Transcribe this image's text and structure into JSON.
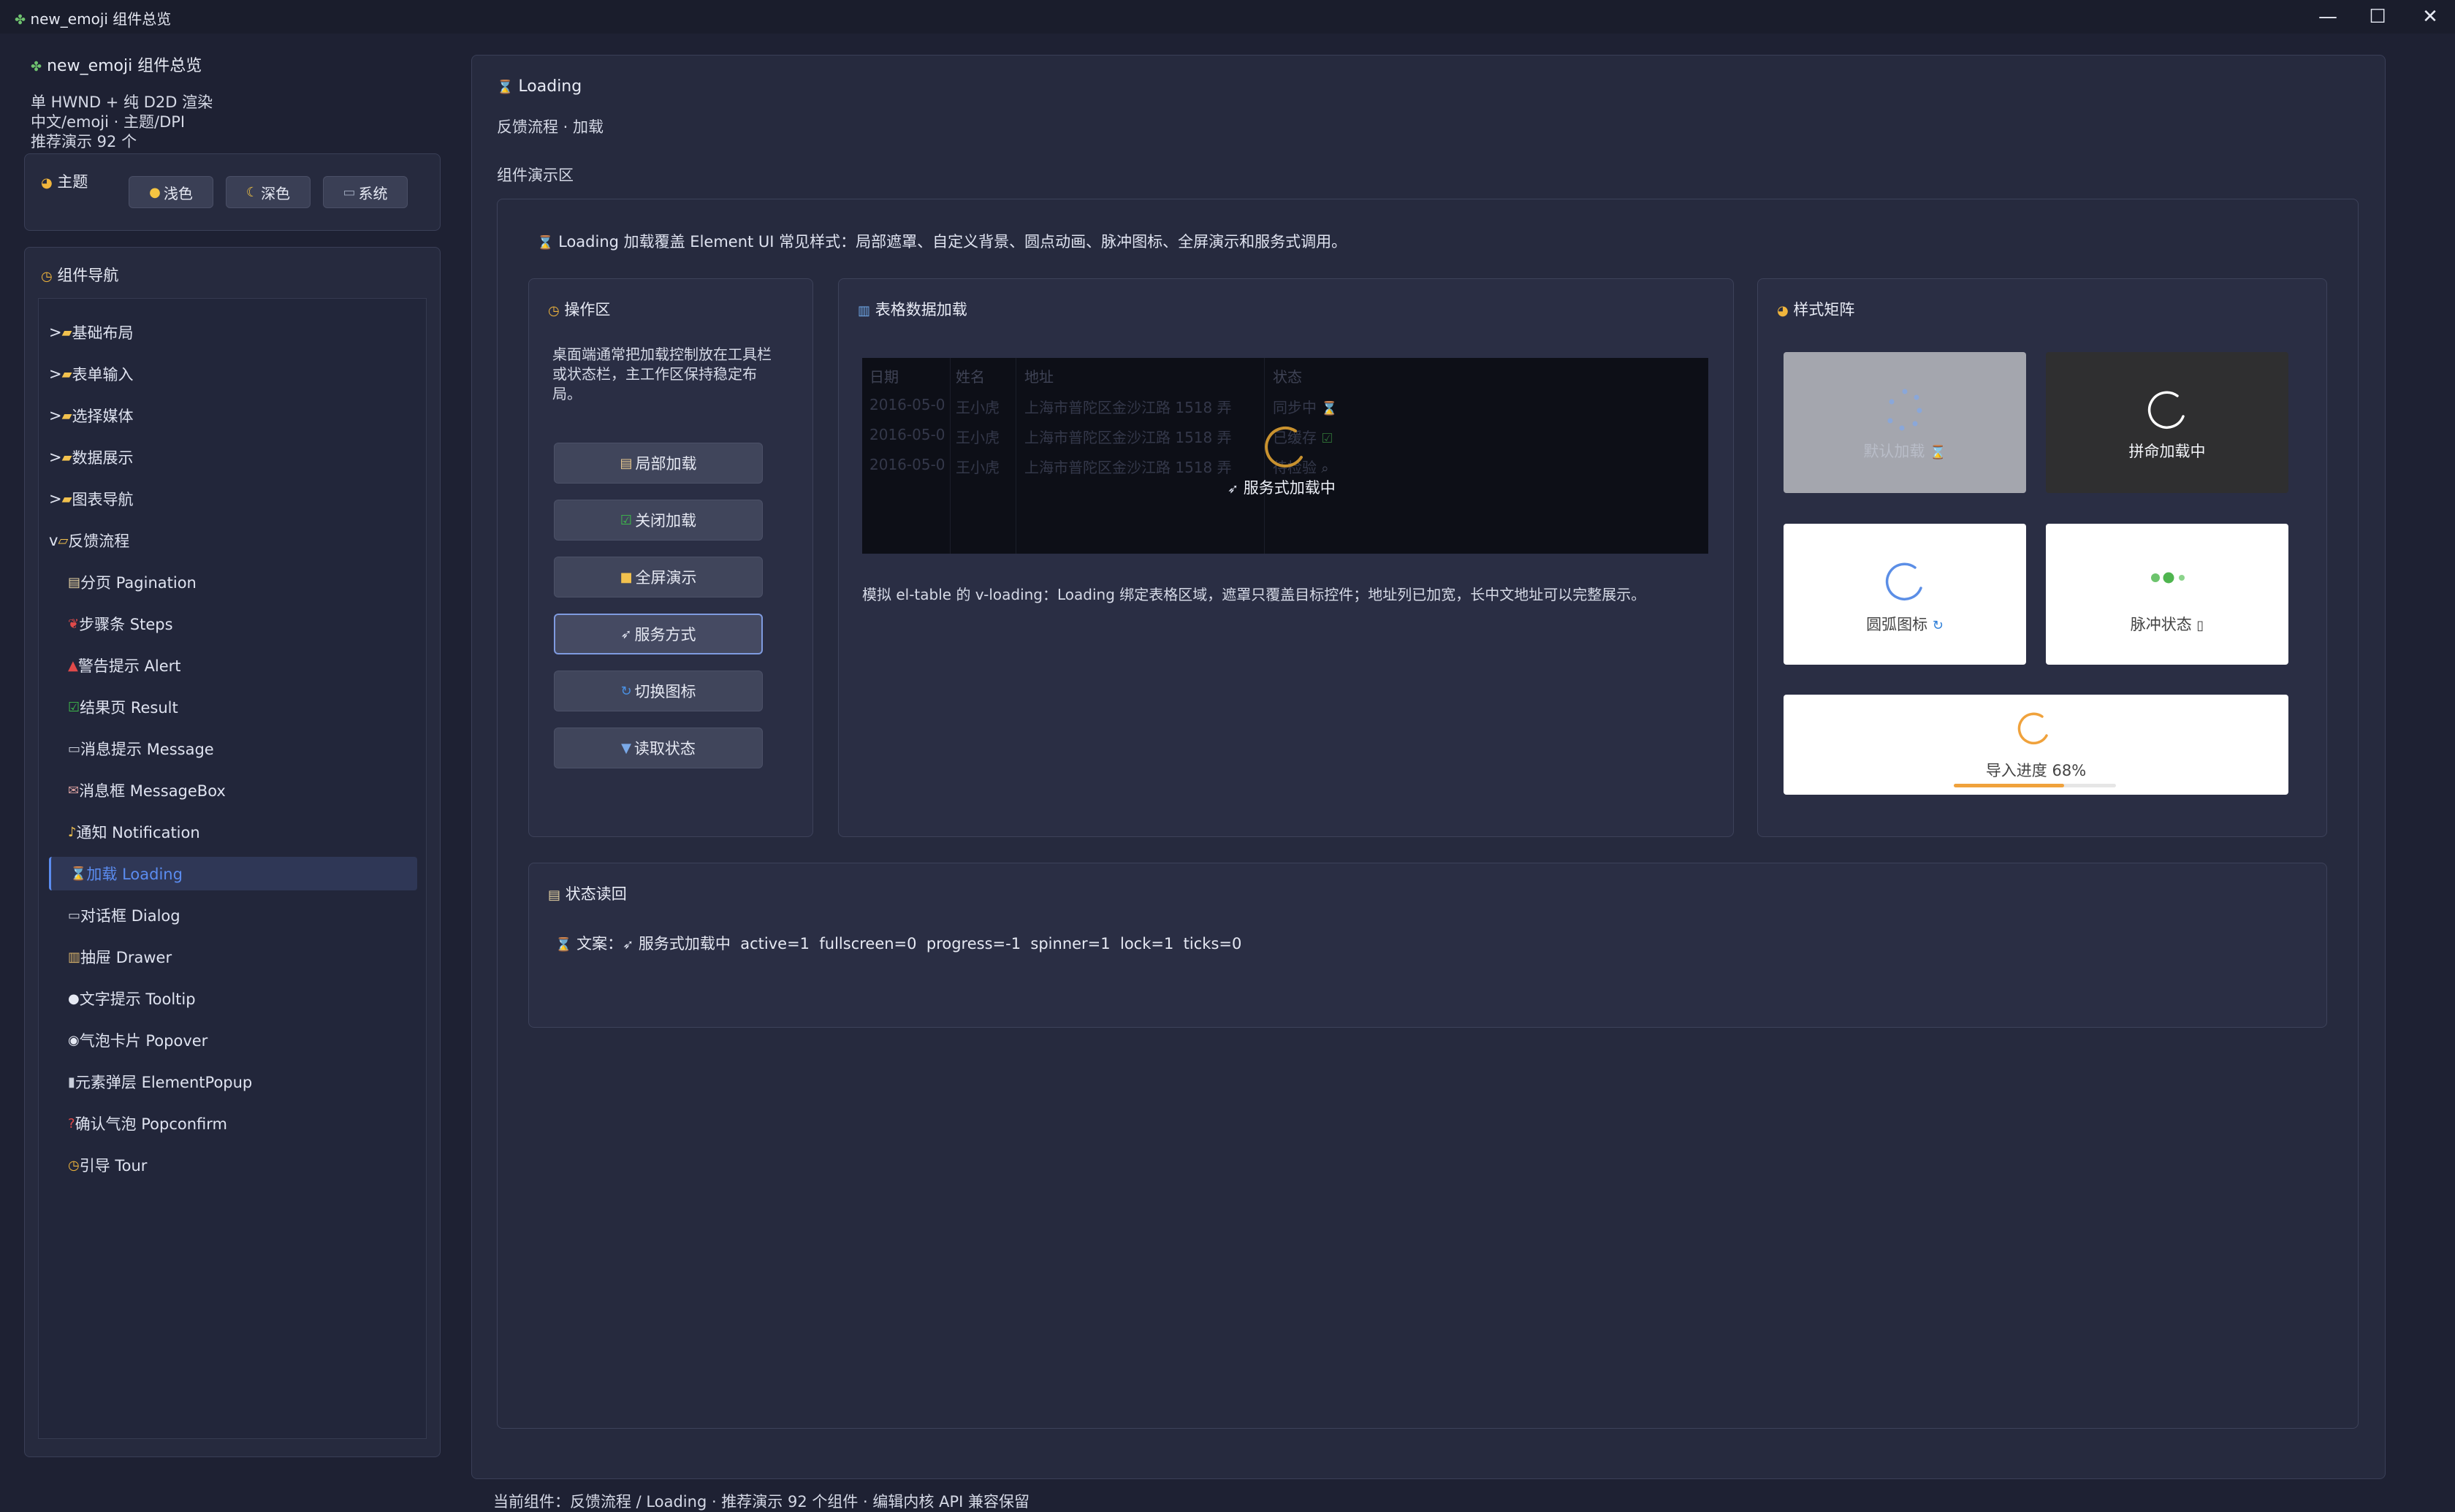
{
  "window": {
    "title": "new_emoji 组件总览",
    "controls": {
      "minimize": "—",
      "maximize": "☐",
      "close": "✕"
    }
  },
  "sidebar": {
    "brand": "new_emoji 组件总览",
    "info_lines": [
      "单 HWND + 纯 D2D 渲染",
      "中文/emoji · 主题/DPI",
      "推荐演示 92 个"
    ],
    "theme": {
      "title": "主题",
      "buttons": [
        {
          "label": "浅色",
          "icon": "sun-icon"
        },
        {
          "label": "深色",
          "icon": "moon-icon"
        },
        {
          "label": "系统",
          "icon": "laptop-icon"
        }
      ]
    },
    "nav": {
      "title": "组件导航",
      "items": [
        {
          "label": "基础布局",
          "icon": "folder-icon",
          "prefix": ">"
        },
        {
          "label": "表单输入",
          "icon": "folder-icon",
          "prefix": ">"
        },
        {
          "label": "选择媒体",
          "icon": "folder-icon",
          "prefix": ">"
        },
        {
          "label": "数据展示",
          "icon": "folder-icon",
          "prefix": ">"
        },
        {
          "label": "图表导航",
          "icon": "folder-icon",
          "prefix": ">"
        },
        {
          "label": "反馈流程",
          "icon": "folder-open-icon",
          "prefix": "v"
        },
        {
          "label": "分页 Pagination",
          "icon": "page-icon"
        },
        {
          "label": "步骤条 Steps",
          "icon": "footprints-icon"
        },
        {
          "label": "警告提示 Alert",
          "icon": "siren-icon"
        },
        {
          "label": "结果页 Result",
          "icon": "check-icon"
        },
        {
          "label": "消息提示 Message",
          "icon": "speech-icon"
        },
        {
          "label": "消息框 MessageBox",
          "icon": "mailbox-icon"
        },
        {
          "label": "通知 Notification",
          "icon": "bell-icon"
        },
        {
          "label": "加载 Loading",
          "icon": "hourglass-icon",
          "active": true
        },
        {
          "label": "对话框 Dialog",
          "icon": "speech-icon"
        },
        {
          "label": "抽屉 Drawer",
          "icon": "drawer-icon"
        },
        {
          "label": "文字提示 Tooltip",
          "icon": "bubble-icon"
        },
        {
          "label": "气泡卡片 Popover",
          "icon": "bubbles-icon"
        },
        {
          "label": "元素弹层 ElementPopup",
          "icon": "mouse-icon"
        },
        {
          "label": "确认气泡 Popconfirm",
          "icon": "question-icon"
        },
        {
          "label": "引导 Tour",
          "icon": "compass-icon"
        }
      ]
    }
  },
  "main": {
    "title": "Loading",
    "subtitle": "反馈流程 · 加载",
    "demo_label": "组件演示区",
    "description": "Loading 加载覆盖 Element UI 常见样式：局部遮罩、自定义背景、圆点动画、脉冲图标、全屏演示和服务式调用。",
    "ops": {
      "title": "操作区",
      "text": [
        "桌面端通常把加载控制放在工具栏",
        "或状态栏，主工作区保持稳定布",
        "局。"
      ],
      "buttons": [
        {
          "label": "局部加载",
          "icon": "scroll-icon"
        },
        {
          "label": "关闭加载",
          "icon": "check-icon"
        },
        {
          "label": "全屏演示",
          "icon": "lock-icon"
        },
        {
          "label": "服务方式",
          "icon": "rocket-icon",
          "selected": true
        },
        {
          "label": "切换图标",
          "icon": "refresh-icon"
        },
        {
          "label": "读取状态",
          "icon": "inbox-icon"
        }
      ]
    },
    "table": {
      "title": "表格数据加载",
      "headers": [
        "日期",
        "姓名",
        "地址",
        "状态"
      ],
      "rows": [
        [
          "2016-05-0",
          "王小虎",
          "上海市普陀区金沙江路 1518 弄",
          "同步中"
        ],
        [
          "2016-05-0",
          "王小虎",
          "上海市普陀区金沙江路 1518 弄",
          "已缓存"
        ],
        [
          "2016-05-0",
          "王小虎",
          "上海市普陀区金沙江路 1518 弄",
          "待检验"
        ]
      ],
      "overlay_text": "服务式加载中",
      "note": "模拟 el-table 的 v-loading：Loading 绑定表格区域，遮罩只覆盖目标控件；地址列已加宽，长中文地址可以完整展示。"
    },
    "styles": {
      "title": "样式矩阵",
      "tiles": [
        {
          "label": "默认加载"
        },
        {
          "label": "拼命加载中"
        },
        {
          "label": "圆弧图标"
        },
        {
          "label": "脉冲状态"
        },
        {
          "label": "导入进度 68%",
          "progress": 0.68
        }
      ]
    },
    "status": {
      "title": "状态读回",
      "prefix": "文案：",
      "text": "服务式加载中  active=1  fullscreen=0  progress=-1  spinner=1  lock=1  ticks=0"
    }
  },
  "footer": "当前组件：反馈流程 / Loading · 推荐演示 92 个组件 · 编辑内核 API 兼容保留"
}
